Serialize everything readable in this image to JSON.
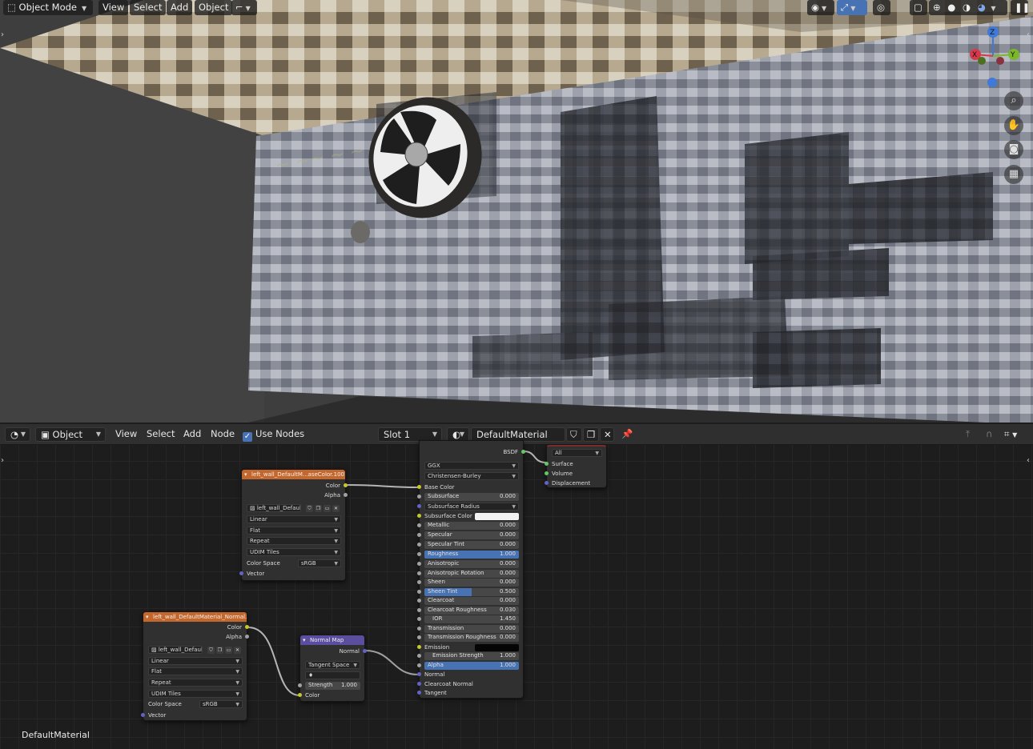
{
  "viewport": {
    "mode": "Object Mode",
    "menu": [
      "View",
      "Select",
      "Add",
      "Object"
    ],
    "gizmo": {
      "z": "Z",
      "x": "X",
      "y": "Y"
    },
    "nav_icons": [
      "zoom-icon",
      "hand-pan-icon",
      "camera-icon",
      "grid-ortho-icon"
    ]
  },
  "node_editor": {
    "object_type": "Object",
    "menu": [
      "View",
      "Select",
      "Add",
      "Node"
    ],
    "use_nodes_label": "Use Nodes",
    "slot": "Slot 1",
    "material": "DefaultMaterial",
    "footer_material": "DefaultMaterial"
  },
  "nodes": {
    "base_tex": {
      "title": "left_wall_DefaultM...aseColor.1001.png",
      "out_color": "Color",
      "out_alpha": "Alpha",
      "image": "left_wall_Default...",
      "interp": "Linear",
      "proj": "Flat",
      "ext": "Repeat",
      "source": "UDIM Tiles",
      "cs_label": "Color Space",
      "cs_value": "sRGB",
      "in_vector": "Vector"
    },
    "normal_tex": {
      "title": "left_wall_DefaultMaterial_Normal.100...",
      "out_color": "Color",
      "out_alpha": "Alpha",
      "image": "left_wall_Default...",
      "interp": "Linear",
      "proj": "Flat",
      "ext": "Repeat",
      "source": "UDIM Tiles",
      "cs_label": "Color Space",
      "cs_value": "sRGB",
      "in_vector": "Vector"
    },
    "normal_map": {
      "title": "Normal Map",
      "out_normal": "Normal",
      "space": "Tangent Space",
      "uv": "♦",
      "strength_label": "Strength",
      "strength_value": "1.000",
      "in_color": "Color"
    },
    "bsdf": {
      "out": "BSDF",
      "distribution": "GGX",
      "subsurface_method": "Christensen-Burley",
      "base_color": "Base Color",
      "subsurface": {
        "label": "Subsurface",
        "value": "0.000"
      },
      "subsurface_radius": "Subsurface Radius",
      "subsurface_color": "Subsurface Color",
      "metallic": {
        "label": "Metallic",
        "value": "0.000"
      },
      "specular": {
        "label": "Specular",
        "value": "0.000"
      },
      "specular_tint": {
        "label": "Specular Tint",
        "value": "0.000"
      },
      "roughness": {
        "label": "Roughness",
        "value": "1.000"
      },
      "anisotropic": {
        "label": "Anisotropic",
        "value": "0.000"
      },
      "anisotropic_rotation": {
        "label": "Anisotropic Rotation",
        "value": "0.000"
      },
      "sheen": {
        "label": "Sheen",
        "value": "0.000"
      },
      "sheen_tint": {
        "label": "Sheen Tint",
        "value": "0.500"
      },
      "clearcoat": {
        "label": "Clearcoat",
        "value": "0.000"
      },
      "clearcoat_roughness": {
        "label": "Clearcoat Roughness",
        "value": "0.030"
      },
      "ior": {
        "label": "IOR",
        "value": "1.450"
      },
      "transmission": {
        "label": "Transmission",
        "value": "0.000"
      },
      "transmission_roughness": {
        "label": "Transmission Roughness",
        "value": "0.000"
      },
      "emission": "Emission",
      "emission_strength": {
        "label": "Emission Strength",
        "value": "1.000"
      },
      "alpha": {
        "label": "Alpha",
        "value": "1.000"
      },
      "normal": "Normal",
      "clearcoat_normal": "Clearcoat Normal",
      "tangent": "Tangent"
    },
    "output": {
      "target": "All",
      "surface": "Surface",
      "volume": "Volume",
      "displacement": "Displacement"
    }
  },
  "colors": {
    "texture_header": "#c4672d",
    "vector_header": "#5b4e9f",
    "accent_blue": "#4772b3"
  }
}
